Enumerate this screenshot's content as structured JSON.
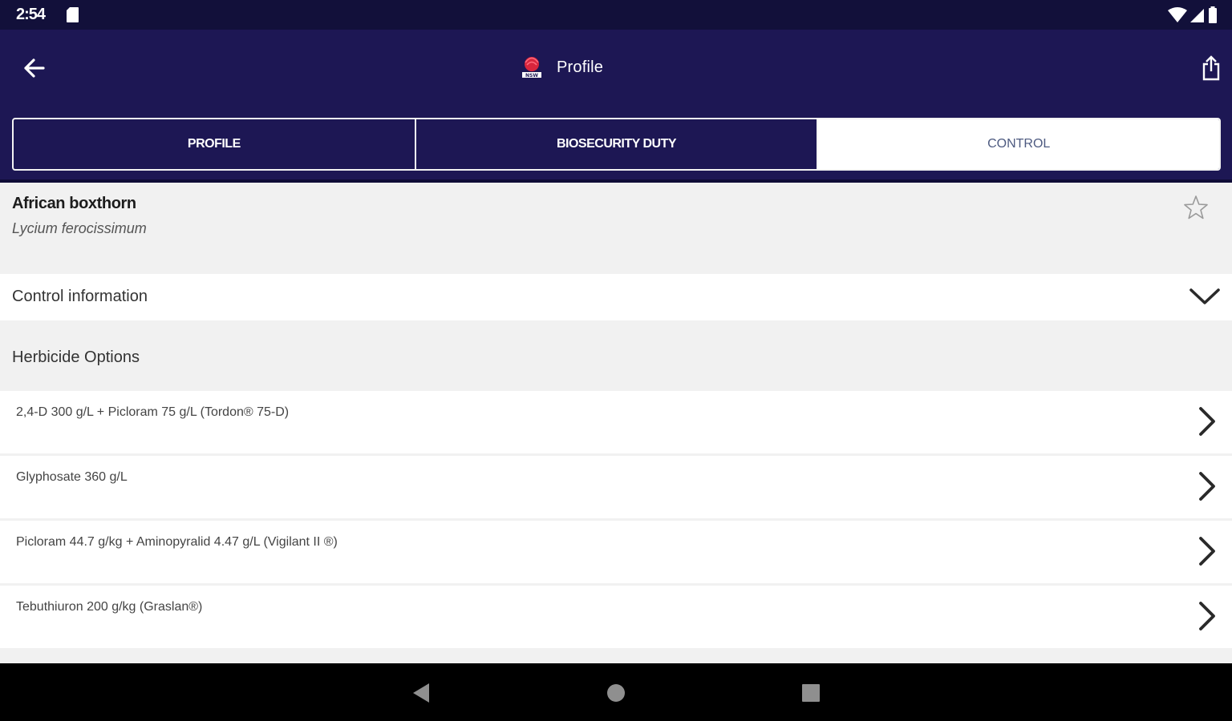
{
  "status_bar": {
    "time": "2:54"
  },
  "app_bar": {
    "title": "Profile",
    "back_icon": "arrow-left-icon",
    "share_icon": "share-icon",
    "logo_icon": "nsw-waratah-logo"
  },
  "tabs": [
    {
      "label": "PROFILE",
      "active": false
    },
    {
      "label": "BIOSECURITY DUTY",
      "active": false
    },
    {
      "label": "CONTROL",
      "active": true
    }
  ],
  "species": {
    "common_name": "African boxthorn",
    "latin_name": "Lycium ferocissimum",
    "favorite_icon": "star-outline-icon"
  },
  "control_information": {
    "label": "Control information",
    "icon": "chevron-down-icon"
  },
  "herbicide_section": {
    "title": "Herbicide Options",
    "items": [
      {
        "label": "2,4-D 300 g/L + Picloram 75 g/L  (Tordon® 75-D)"
      },
      {
        "label": "Glyphosate 360 g/L"
      },
      {
        "label": "Picloram 44.7 g/kg + Aminopyralid 4.47 g/L  (Vigilant II ®)"
      },
      {
        "label": "Tebuthiuron 200 g/kg  (Graslan®)"
      }
    ]
  },
  "colors": {
    "app_bar": "#1d1754",
    "status_bar": "#12103a",
    "active_tab_text": "#4d5a80",
    "background": "#f1f1f1"
  }
}
